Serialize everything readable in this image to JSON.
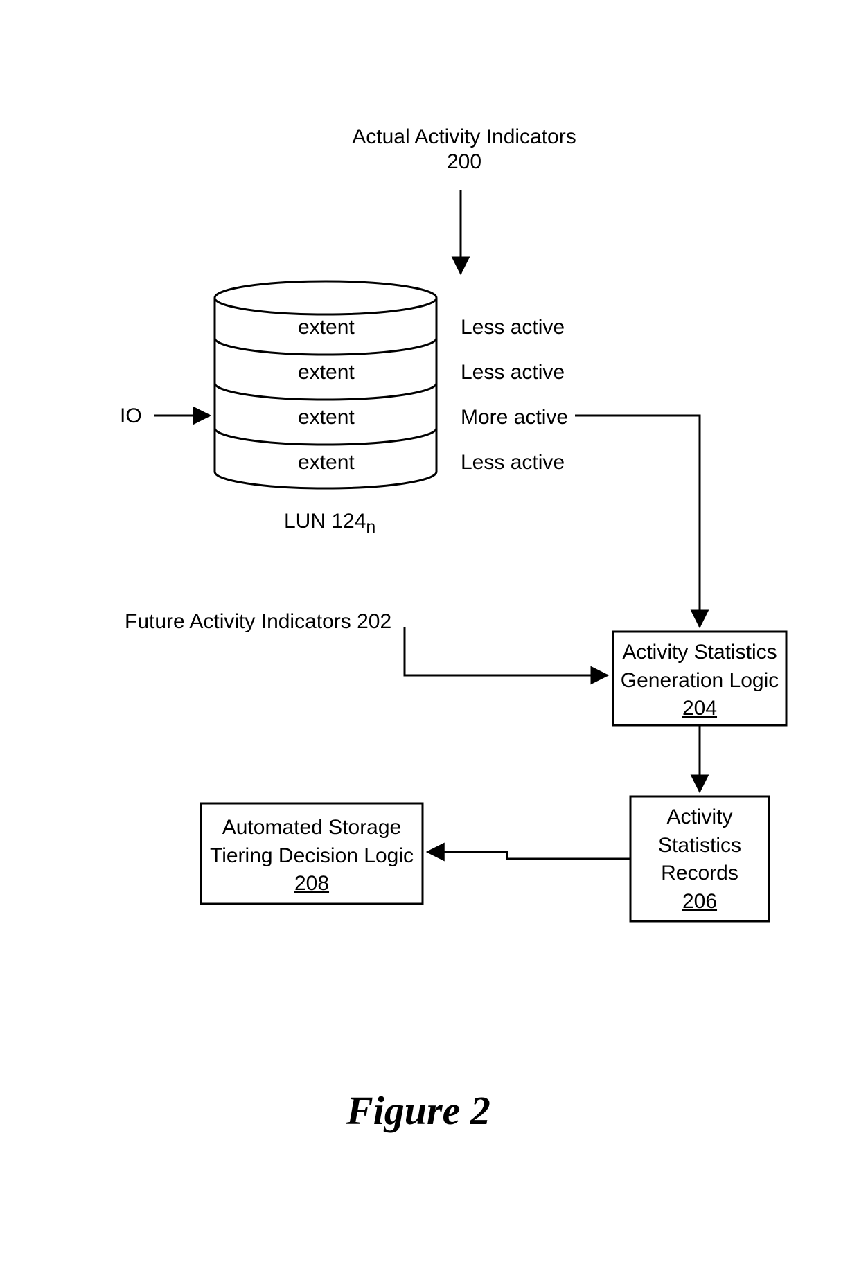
{
  "header": {
    "title_line1": "Actual Activity Indicators",
    "title_ref": "200"
  },
  "io_label": "IO",
  "lun_label_prefix": "LUN 124",
  "lun_label_sub": "n",
  "cylinder": {
    "extents": [
      "extent",
      "extent",
      "extent",
      "extent"
    ],
    "activity": [
      "Less active",
      "Less active",
      "More active",
      "Less active"
    ]
  },
  "future_label": "Future Activity Indicators 202",
  "box204": {
    "line1": "Activity Statistics",
    "line2": "Generation Logic",
    "ref": "204"
  },
  "box206": {
    "line1": "Activity",
    "line2": "Statistics",
    "line3": "Records",
    "ref": "206"
  },
  "box208": {
    "line1": "Automated Storage",
    "line2": "Tiering Decision Logic",
    "ref": "208"
  },
  "figure_caption": "Figure 2"
}
